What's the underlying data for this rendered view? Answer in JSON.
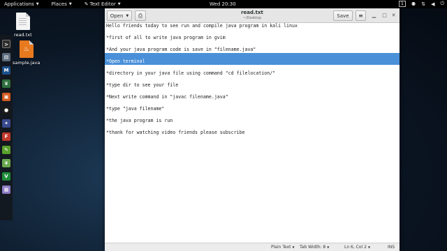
{
  "topbar": {
    "applications": "Applications",
    "places": "Places",
    "text_editor": "Text Editor",
    "clock": "Wed 20:30",
    "workspace": "1",
    "icons": [
      "accessibility-icon",
      "network-icon",
      "volume-icon",
      "power-icon"
    ]
  },
  "desktop": {
    "icons": [
      {
        "name": "read.txt",
        "type": "text-file-icon"
      },
      {
        "name": "sample.java",
        "type": "java-file-icon"
      }
    ]
  },
  "dock": {
    "apps": [
      "terminal-icon",
      "files-icon",
      "metasploit-icon",
      "armitage-icon",
      "burpsuite-icon",
      "maltego-icon",
      "beef-icon",
      "faraday-icon",
      "leafpad-icon",
      "cherrytree-icon",
      "vim-icon",
      "gedit-icon"
    ]
  },
  "window": {
    "title": "read.txt",
    "subtitle": "~/Desktop",
    "open_label": "Open",
    "save_label": "Save"
  },
  "editor": {
    "lines": [
      "Hello friends today to see run and compile java program in kali linux",
      "",
      "*first of all to write java program in gvim",
      "",
      "*And your java program code is save in \"filename.java\"",
      "",
      "*Open terminal",
      "",
      "*directory in your java file using command \"cd filelocation/\"",
      "",
      "*type dir to see your file",
      "",
      "*Next write command in \"javac filename.java\"",
      "",
      "*type \"java filename\"",
      "",
      "*the java program is run",
      "",
      "*thank for watching video friends please subscribe"
    ],
    "selected_line_index": 6
  },
  "statusbar": {
    "syntax": "Plain Text",
    "tab_width": "Tab Width: 8",
    "position": "Ln 6, Col 2",
    "mode": "INS"
  }
}
